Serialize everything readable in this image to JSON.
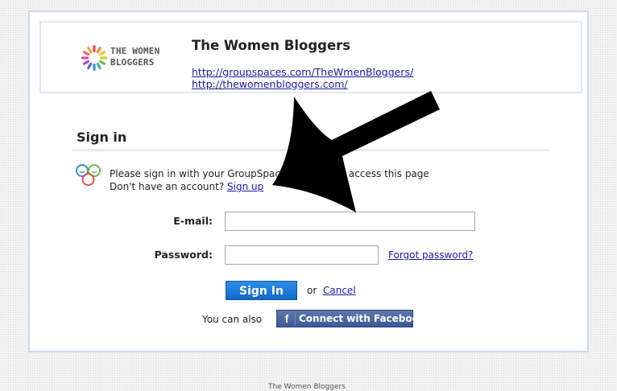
{
  "header": {
    "logo_line1": "THE WOMEN",
    "logo_line2": "BLOGGERS",
    "group_name": "The Women Bloggers",
    "link1": "http://groupspaces.com/TheWmenBloggers/",
    "link2": "http://thewomenbloggers.com/"
  },
  "signin": {
    "title": "Sign in",
    "info_line1": "Please sign in with your GroupSpaces account to access this page",
    "info_line2_prefix": "Don't have an account?",
    "signup_link": "Sign up"
  },
  "form": {
    "email_label": "E-mail:",
    "email_value": "",
    "password_label": "Password:",
    "password_value": "",
    "forgot_link": "Forgot password?",
    "submit_label": "Sign In",
    "or_text": "or",
    "cancel_link": "Cancel",
    "also_text": "You can also",
    "facebook_label": "Connect with Facebook"
  },
  "footer": {
    "text": "The Women Bloggers"
  },
  "colors": {
    "link": "#1a1aa6",
    "primary_button": "#1a73d9",
    "facebook": "#3b5998",
    "card_border": "#c9d9ec"
  },
  "icons": {
    "logo": "sunburst-logo-icon",
    "groupspaces": "groupspaces-faces-icon",
    "facebook": "facebook-f-icon",
    "annotation": "black-arrow-annotation"
  }
}
